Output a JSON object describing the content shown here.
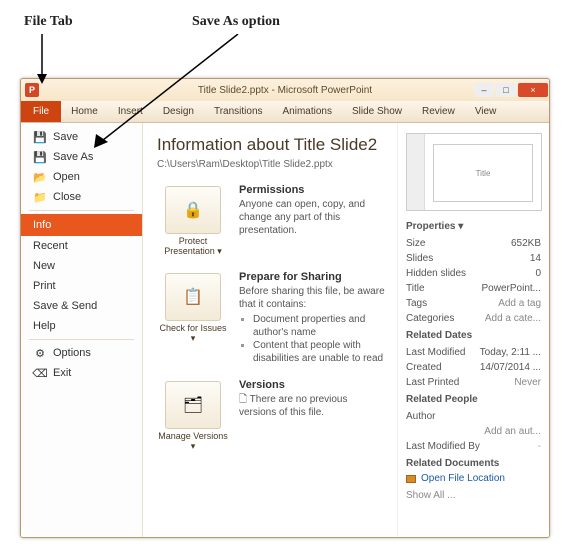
{
  "annotations": {
    "file_tab": "File Tab",
    "save_as": "Save As option"
  },
  "window": {
    "title": "Title Slide2.pptx - Microsoft PowerPoint",
    "buttons": {
      "min": "–",
      "max": "□",
      "close": "×"
    }
  },
  "ribbon": {
    "file": "File",
    "tabs": [
      "Home",
      "Insert",
      "Design",
      "Transitions",
      "Animations",
      "Slide Show",
      "Review",
      "View"
    ]
  },
  "leftmenu": {
    "save": "Save",
    "save_as": "Save As",
    "open": "Open",
    "close": "Close",
    "info": "Info",
    "recent": "Recent",
    "new": "New",
    "print": "Print",
    "save_send": "Save & Send",
    "help": "Help",
    "options": "Options",
    "exit": "Exit"
  },
  "info": {
    "title": "Information about Title Slide2",
    "path": "C:\\Users\\Ram\\Desktop\\Title Slide2.pptx",
    "sections": {
      "protect": {
        "btn": "Protect Presentation ▾",
        "head": "Permissions",
        "body": "Anyone can open, copy, and change any part of this presentation."
      },
      "check": {
        "btn": "Check for Issues ▾",
        "head": "Prepare for Sharing",
        "body": "Before sharing this file, be aware that it contains:",
        "l1": "Document properties and author's name",
        "l2": "Content that people with disabilities are unable to read"
      },
      "versions": {
        "btn": "Manage Versions ▾",
        "head": "Versions",
        "body": "There are no previous versions of this file.",
        "icon": "🗋"
      }
    }
  },
  "props": {
    "head": "Properties ▾",
    "rows": {
      "size_k": "Size",
      "size_v": "652KB",
      "slides_k": "Slides",
      "slides_v": "14",
      "hidden_k": "Hidden slides",
      "hidden_v": "0",
      "title_k": "Title",
      "title_v": "PowerPoint...",
      "tags_k": "Tags",
      "tags_v": "Add a tag",
      "cat_k": "Categories",
      "cat_v": "Add a cate..."
    },
    "dates_head": "Related Dates",
    "dates": {
      "lm_k": "Last Modified",
      "lm_v": "Today, 2:11 ...",
      "cr_k": "Created",
      "cr_v": "14/07/2014 ...",
      "lp_k": "Last Printed",
      "lp_v": "Never"
    },
    "people_head": "Related People",
    "people": {
      "author_k": "Author",
      "author_v": "Add an aut...",
      "lmb_k": "Last Modified By",
      "lmb_v": "-"
    },
    "docs_head": "Related Documents",
    "open_loc": "Open File Location",
    "show_all": "Show All ..."
  },
  "thumb": {
    "text": "Title"
  }
}
